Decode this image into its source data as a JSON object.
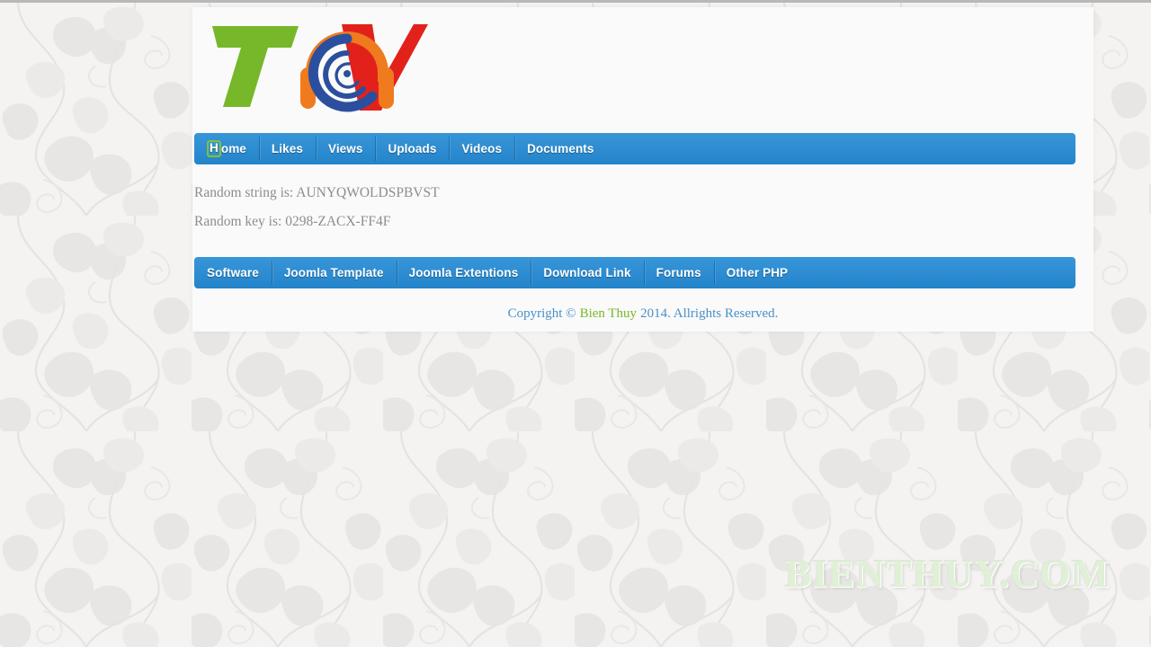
{
  "site": {
    "logo_name": "tcv-logo",
    "logo_text": "TCV"
  },
  "primary_nav": {
    "name": "primary-navigation",
    "items": [
      {
        "label": "Home",
        "highlight_first_letter": true
      },
      {
        "label": "Likes",
        "highlight_first_letter": false
      },
      {
        "label": "Views",
        "highlight_first_letter": false
      },
      {
        "label": "Uploads",
        "highlight_first_letter": false
      },
      {
        "label": "Videos",
        "highlight_first_letter": false
      },
      {
        "label": "Documents",
        "highlight_first_letter": false
      }
    ]
  },
  "content": {
    "lines": [
      {
        "label": "Random string is:",
        "value": "AUNYQWOLDSPBVST"
      },
      {
        "label": "Random key is:",
        "value": "0298-ZACX-FF4F"
      }
    ]
  },
  "secondary_nav": {
    "name": "secondary-navigation",
    "items": [
      {
        "label": "Software"
      },
      {
        "label": "Joomla Template"
      },
      {
        "label": "Joomla Extentions"
      },
      {
        "label": "Download Link"
      },
      {
        "label": "Forums"
      },
      {
        "label": "Other PHP"
      }
    ]
  },
  "footer": {
    "prefix": "Copyright ©",
    "brand": "Bien Thuy",
    "suffix": "2014. Allrights Reserved."
  },
  "watermark": {
    "text": "BIENTHUY.COM"
  },
  "colors": {
    "nav_blue_top": "#3795d8",
    "nav_blue_bottom": "#2484c9",
    "logo_green": "#76b82a",
    "logo_orange": "#f07a1e",
    "logo_red": "#e3211b",
    "logo_blue": "#2b4f9e",
    "footer_blue": "#4a90c8",
    "footer_green": "#76b82a",
    "body_text": "#8d8d8d",
    "page_bg": "#f4f3f1",
    "container_bg": "#fafafa",
    "watermark": "#dff0d5"
  }
}
